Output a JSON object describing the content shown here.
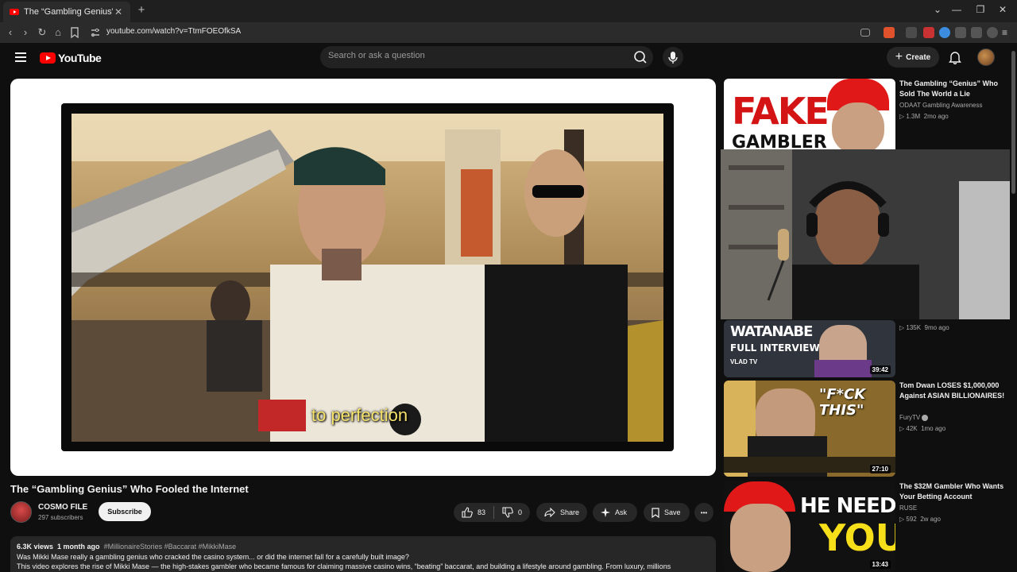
{
  "browser": {
    "tab_title": "The “Gambling Genius” Who Fooled the Internet - YouTube",
    "url": "youtube.com/watch?v=TtmFOEOfkSA"
  },
  "header": {
    "logo_text": "YouTube",
    "search_placeholder": "Search or ask a question",
    "create_label": "Create"
  },
  "video": {
    "caption": "to perfection",
    "title": "The “Gambling Genius” Who Fooled the Internet",
    "channel": "COSMO FILE",
    "subscribers": "297 subscribers",
    "subscribe_label": "Subscribe",
    "likes": "83",
    "dislikes": "0",
    "share_label": "Share",
    "ask_label": "Ask",
    "save_label": "Save",
    "more_label": "•••"
  },
  "description": {
    "views": "6.3K views",
    "age": "1 month ago",
    "tags": "#MillionaireStories #Baccarat #MikkiMase",
    "line1": "Was Mikki Mase really a gambling genius who cracked the casino system... or did the internet fall for a carefully built image?",
    "line2": "This video explores the rise of Mikki Mase — the high-stakes gambler who became famous for claiming massive casino wins, “beating” baccarat, and building a lifestyle around gambling. From luxury, millions"
  },
  "recommendations": [
    {
      "title": "The Gambling “Genius” Who Sold The World a Lie",
      "channel": "ODAAT Gambling Awareness",
      "views": "1.3M",
      "age": "2mo ago",
      "thumb_text_1": "FAKE",
      "thumb_text_2": "GAMBLER"
    },
    {
      "views": "135K",
      "age": "9mo ago",
      "duration": "39:42",
      "thumb_text_1": "WATANABE",
      "thumb_text_2": "FULL INTERVIEW",
      "thumb_text_3": "VLAD TV"
    },
    {
      "title": "Tom Dwan LOSES $1,000,000 Against ASIAN BILLIONAIRES!",
      "channel": "FuryTV",
      "views": "42K",
      "age": "1mo ago",
      "duration": "27:10",
      "thumb_text_1": "\"F*CK THIS\""
    },
    {
      "title": "The $32M Gambler Who Wants Your Betting Account",
      "channel": "RUSE",
      "views": "592",
      "age": "2w ago",
      "duration": "13:43",
      "thumb_text_1": "HE NEEDS",
      "thumb_text_2": "YOU"
    }
  ],
  "colors": {
    "bg": "#0f0f0f",
    "pill": "#272727",
    "brand_red": "#ff0000",
    "caption_yellow": "#f5e36a"
  }
}
